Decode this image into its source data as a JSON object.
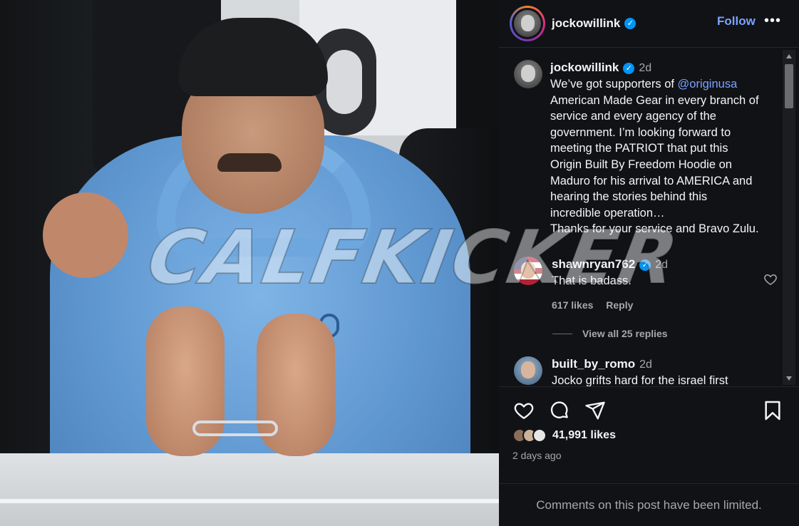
{
  "watermark": "CALFKICKER",
  "post": {
    "username": "jockowillink",
    "follow_label": "Follow",
    "more_label": "•••",
    "caption": {
      "username": "jockowillink",
      "age": "2d",
      "text_before_mention": "We’ve got supporters of ",
      "mention": "@originusa",
      "text_after_mention": "\nAmerican Made Gear in every branch of\nservice and every agency of the\ngovernment. I’m looking forward to\nmeeting the PATRIOT that put this\nOrigin Built By Freedom Hoodie on\nMaduro for his arrival to AMERICA and\nhearing the stories behind this\nincredible operation…\nThanks for your service and Bravo Zulu."
    },
    "comments": [
      {
        "username": "shawnryan762",
        "verified": true,
        "age": "2d",
        "text": "That is badass.",
        "likes": "617 likes",
        "reply_label": "Reply",
        "view_replies": "View all 25 replies"
      },
      {
        "username": "built_by_romo",
        "age": "2d",
        "text": "Jocko grifts hard for the israel first"
      }
    ],
    "likes_count": "41,991 likes",
    "time": "2 days ago",
    "limited_notice": "Comments on this post have been limited."
  },
  "colors": {
    "accent": "#7aa2ff",
    "verified": "#0095f6",
    "panel_bg": "#101216",
    "muted_text": "#a8a8a8"
  },
  "icons": [
    "heart-icon",
    "comment-icon",
    "share-icon",
    "bookmark-icon",
    "more-icon",
    "verified-icon"
  ]
}
